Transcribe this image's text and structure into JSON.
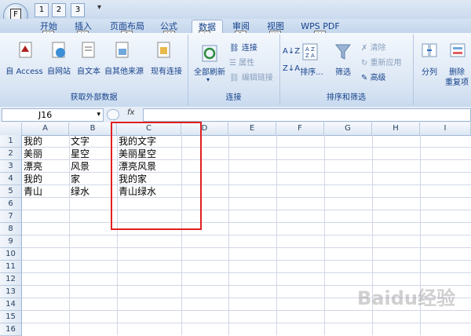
{
  "quick_access": {
    "office_btn": "F",
    "keys": [
      "1",
      "2",
      "3"
    ]
  },
  "tabs": [
    {
      "label": "开始",
      "key": "H"
    },
    {
      "label": "插入",
      "key": "N"
    },
    {
      "label": "页面布局",
      "key": "P"
    },
    {
      "label": "公式",
      "key": "M"
    },
    {
      "label": "数据",
      "key": "A"
    },
    {
      "label": "审阅",
      "key": "R"
    },
    {
      "label": "视图",
      "key": "W"
    },
    {
      "label": "WPS PDF",
      "key": "Y"
    }
  ],
  "ribbon": {
    "external": {
      "access": "自 Access",
      "web": "自网站",
      "text": "自文本",
      "other": "自其他来源",
      "existing": "现有连接",
      "label": "获取外部数据"
    },
    "connections": {
      "refresh": "全部刷新",
      "connect": "连接",
      "props": "属性",
      "edit_links": "编辑链接",
      "label": "连接"
    },
    "sort": {
      "sort": "排序...",
      "filter": "筛选",
      "clear": "清除",
      "reapply": "重新应用",
      "advanced": "高级",
      "label": "排序和筛选"
    },
    "tools": {
      "split": "分列",
      "remove_dup": "删除",
      "remove_dup2": "重复项"
    }
  },
  "formula_bar": {
    "name_box": "J16",
    "fx": "fx",
    "value": ""
  },
  "columns": [
    "A",
    "B",
    "C",
    "D",
    "E",
    "F",
    "G",
    "H",
    "I"
  ],
  "rows": [
    "1",
    "2",
    "3",
    "4",
    "5",
    "6",
    "7",
    "8",
    "9",
    "10",
    "11",
    "12",
    "13",
    "14",
    "15",
    "16"
  ],
  "cells": {
    "A": [
      "我的",
      "美丽",
      "漂亮",
      "我的",
      "青山"
    ],
    "B": [
      "文字",
      "星空",
      "风景",
      "家",
      "绿水"
    ],
    "C": [
      "我的文字",
      "美丽星空",
      "漂亮风景",
      "我的家",
      "青山绿水"
    ]
  },
  "watermark": "Baidu经验",
  "colors": {
    "highlight_box": "#e02020",
    "ribbon_text": "#15428b"
  }
}
